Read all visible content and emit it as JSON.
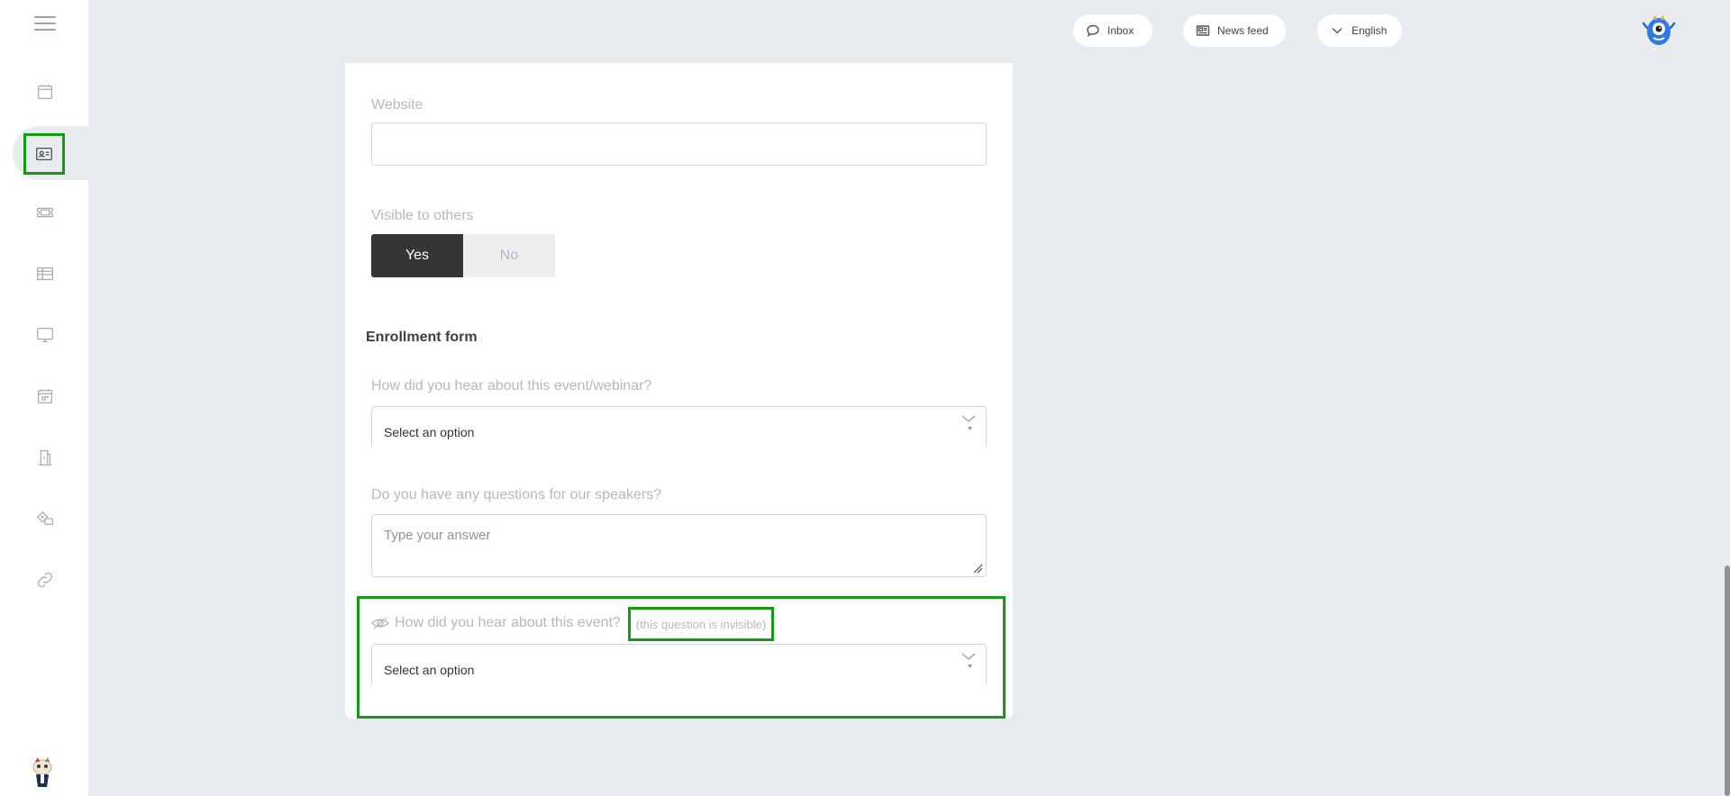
{
  "topbar": {
    "inbox_label": "Inbox",
    "newsfeed_label": "News feed",
    "language_label": "English"
  },
  "sidebar": {
    "items": [
      {
        "icon": "calendar-icon"
      },
      {
        "icon": "contact-card-icon",
        "active": true
      },
      {
        "icon": "ticket-icon"
      },
      {
        "icon": "table-icon"
      },
      {
        "icon": "monitor-icon"
      },
      {
        "icon": "schedule-icon"
      },
      {
        "icon": "building-icon"
      },
      {
        "icon": "sponsor-icon"
      },
      {
        "icon": "link-icon"
      }
    ]
  },
  "form": {
    "website_label": "Website",
    "visible_label": "Visible to others",
    "yes_label": "Yes",
    "no_label": "No",
    "enrollment_title": "Enrollment form",
    "q1_label": "How did you hear about this event/webinar?",
    "q1_value": "Select an option",
    "q2_label": "Do you have any questions for our speakers?",
    "q2_placeholder": "Type your answer",
    "q3_label": "How did you hear about this event?",
    "q3_badge": "(this question is invisible)",
    "q3_value": "Select an option"
  },
  "colors": {
    "highlight": "#169a16",
    "background": "#e8ecee",
    "toggle_active": "#333537"
  }
}
